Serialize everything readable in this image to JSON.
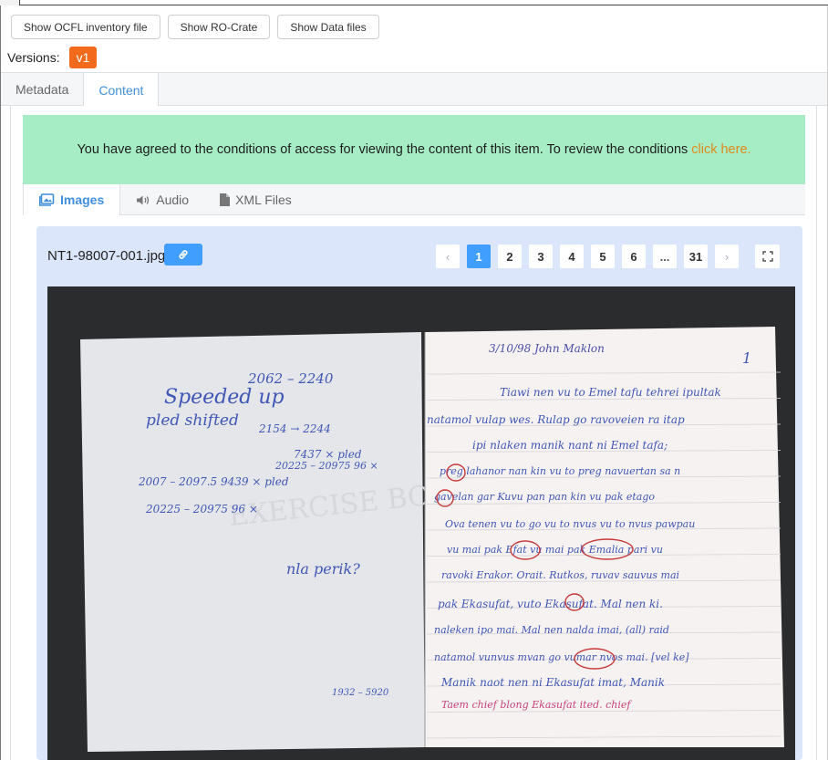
{
  "toolbar": {
    "show_inventory": "Show OCFL inventory file",
    "show_rocrate": "Show RO-Crate",
    "show_datafiles": "Show Data files"
  },
  "versions": {
    "label": "Versions:",
    "current": "v1"
  },
  "main_tabs": {
    "metadata": "Metadata",
    "content": "Content"
  },
  "agreement": {
    "text": "You have agreed to the conditions of access for viewing the content of this item. To review the conditions",
    "link": "click here."
  },
  "content_tabs": {
    "images": "Images",
    "audio": "Audio",
    "xml": "XML Files"
  },
  "viewer": {
    "file_name": "NT1-98007-001.jpg",
    "pages": [
      "1",
      "2",
      "3",
      "4",
      "5",
      "6",
      "...",
      "31"
    ],
    "current_page": "1",
    "prev": "‹",
    "next": "›"
  },
  "manuscript": {
    "left_notes": [
      "Speeded up",
      "2062 – 2240",
      "pled shifted",
      "2154 → 2244",
      "2097.5",
      "2007 – 2097.5 9439 × pled",
      "20225 – 20975 96 ×",
      "7437 × pled",
      "nla perik?",
      "1932 – 5920"
    ],
    "right_lines": [
      "3/10/98 John Maklon",
      "Tiawi nen vu to Emel tafu tehrei ipultak",
      "natamol vulap wes. Rulap go ravoveien ra itap",
      "ipi nlaken manik nant ni Emel tafa;",
      "preg lahanor nan kin vu to preg navuertan sa n",
      "gavelan gar Kuvu pan pan kin vu pak etago",
      "Ova tenen vu to go vu to nvus vu to nvus pawpau",
      "vu mai pak Efat vu mai pak Emalia pari vu",
      "ravoki Erakor. Orait. Rutkos, ruvav sauvus mai",
      "pak Ekasufat, vuto Ekasufat. Mal nen ki.",
      "naleken ipo mai. Mal nen nalda imai, (all) raid",
      "natamol vunvus mvan go vumar nvos mai. [vel ke]",
      "Manik naot nen ni Ekasufat imat, Manik",
      "Taem chief blong Ekasufat ited. chief"
    ],
    "page_number": "1"
  }
}
